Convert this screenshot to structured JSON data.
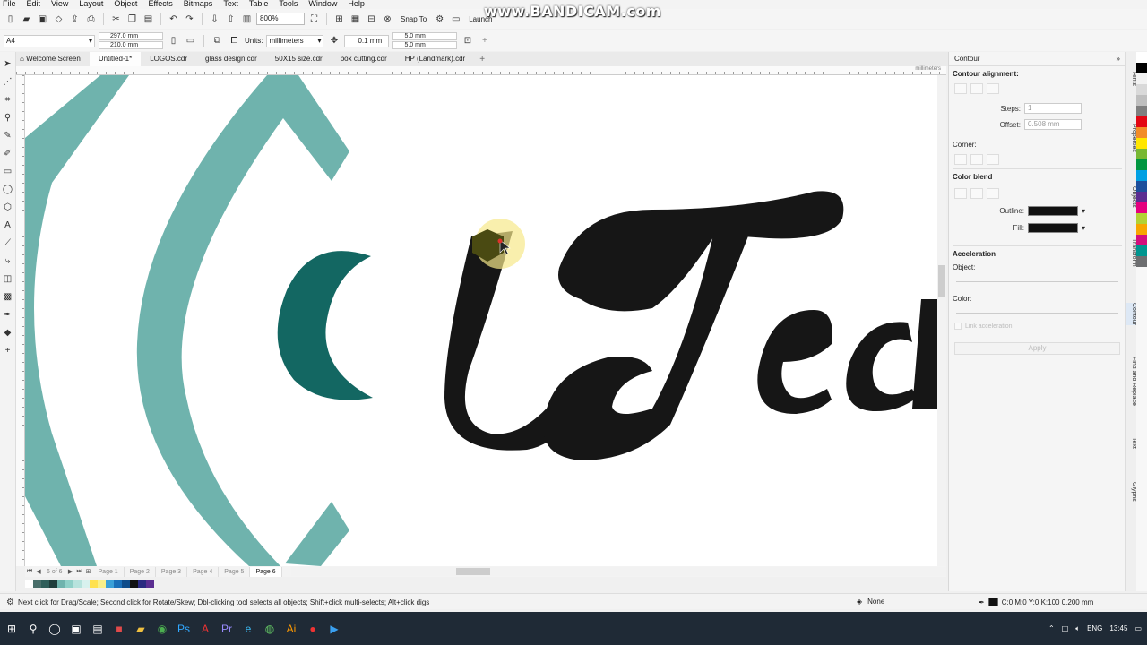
{
  "menu": [
    "File",
    "Edit",
    "View",
    "Layout",
    "Object",
    "Effects",
    "Bitmaps",
    "Text",
    "Table",
    "Tools",
    "Window",
    "Help"
  ],
  "toolbar": {
    "zoom": "800%",
    "snap_to": "Snap To",
    "launch": "Launch"
  },
  "watermark": "www.BANDICAM.com",
  "propbar": {
    "page_preset": "A4",
    "width": "297.0 mm",
    "height": "210.0 mm",
    "units_label": "Units:",
    "units_value": "millimeters",
    "nudge": "0.1 mm",
    "dup_x": "5.0 mm",
    "dup_y": "5.0 mm"
  },
  "tabs": [
    "Welcome Screen",
    "Untitled-1*",
    "LOGOS.cdr",
    "glass design.cdr",
    "50X15 size.cdr",
    "box cutting.cdr",
    "HP (Landmark).cdr"
  ],
  "active_tab_index": 1,
  "ruler_unit": "millimeters",
  "pages": [
    "Page 1",
    "Page 2",
    "Page 3",
    "Page 4",
    "Page 5",
    "Page 6"
  ],
  "page_counter": "6 of 6",
  "active_page_index": 5,
  "status": {
    "message": "Next click for Drag/Scale; Second click for Rotate/Skew; Dbl-clicking tool selects all objects; Shift+click multi-selects; Alt+click digs",
    "fill": "None",
    "outline": "C:0 M:0 Y:0 K:100  0.200 mm"
  },
  "docker": {
    "title": "Contour",
    "alignment_label": "Contour alignment:",
    "steps_label": "Steps:",
    "steps_value": "1",
    "offset_label": "Offset:",
    "offset_value": "0.508 mm",
    "corner_label": "Corner:",
    "color_blend_label": "Color blend",
    "outline_label": "Outline:",
    "fill_label": "Fill:",
    "acceleration_label": "Acceleration",
    "object_label": "Object:",
    "color_label": "Color:",
    "link_label": "Link acceleration",
    "apply_label": "Apply"
  },
  "vtabs": [
    "Hints",
    "Properties",
    "Objects",
    "Transform",
    "Contour",
    "Find and Replace",
    "Text",
    "Glyphs"
  ],
  "canvas_text": "Tech",
  "palette_colors": [
    "#ffffff",
    "#4a6f6b",
    "#2f5e5a",
    "#1f3d3b",
    "#6fb3ad",
    "#8fd0c8",
    "#b7e3dd",
    "#d8f1ee",
    "#ffe14d",
    "#f9f08a",
    "#3aa0d8",
    "#1a6fb8",
    "#0f4c8a",
    "#111111",
    "#2a2a80",
    "#5b2e91"
  ],
  "colorbar": [
    "#ffffff",
    "#000000",
    "#f2f2f2",
    "#d9d9d9",
    "#bfbfbf",
    "#7f7f7f",
    "#e30613",
    "#f28c28",
    "#ffe600",
    "#78b833",
    "#009640",
    "#00a0e3",
    "#1d4f9c",
    "#5c2d91",
    "#e5007e",
    "#b2d235",
    "#f7a600",
    "#d40f7d",
    "#00958f",
    "#6d6e70"
  ],
  "clock": "13:45",
  "lang": "ENG"
}
